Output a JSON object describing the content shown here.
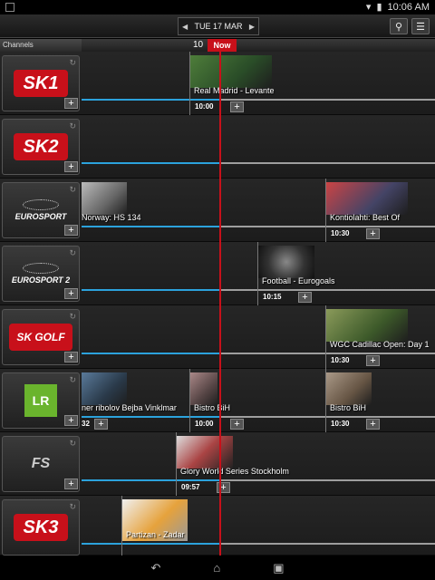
{
  "status": {
    "time": "10:06 AM"
  },
  "header": {
    "date": "TUE 17 MAR"
  },
  "timeline": {
    "hour": "10",
    "now_label": "Now",
    "channels_label": "Channels"
  },
  "channels": [
    {
      "logo": "SK1",
      "programs": [
        {
          "title": "Real Madrid - Levante",
          "start": "10:00"
        }
      ]
    },
    {
      "logo": "SK2",
      "programs": []
    },
    {
      "logo": "EUROSPORT",
      "programs": [
        {
          "title": "Norway: HS 134",
          "start": ""
        },
        {
          "title": "Kontiolahti: Best Of",
          "start": "10:30"
        }
      ]
    },
    {
      "logo": "EUROSPORT 2",
      "programs": [
        {
          "title": "Football - Eurogoals",
          "start": "10:15"
        }
      ]
    },
    {
      "logo": "SK GOLF",
      "programs": [
        {
          "title": "WGC Cadillac Open: Day 1",
          "start": "10:30"
        }
      ]
    },
    {
      "logo": "LR",
      "programs": [
        {
          "title": "ner ribolov Bejba Vinklmar",
          "start": "32"
        },
        {
          "title": "Bistro BiH",
          "start": "10:00"
        },
        {
          "title": "Bistro BiH",
          "start": "10:30"
        }
      ]
    },
    {
      "logo": "FS",
      "programs": [
        {
          "title": "Glory World Series Stockholm",
          "start": "09:57"
        }
      ]
    },
    {
      "logo": "SK3",
      "programs": [
        {
          "title": "Partizan - Zadar",
          "start": ""
        }
      ]
    }
  ]
}
